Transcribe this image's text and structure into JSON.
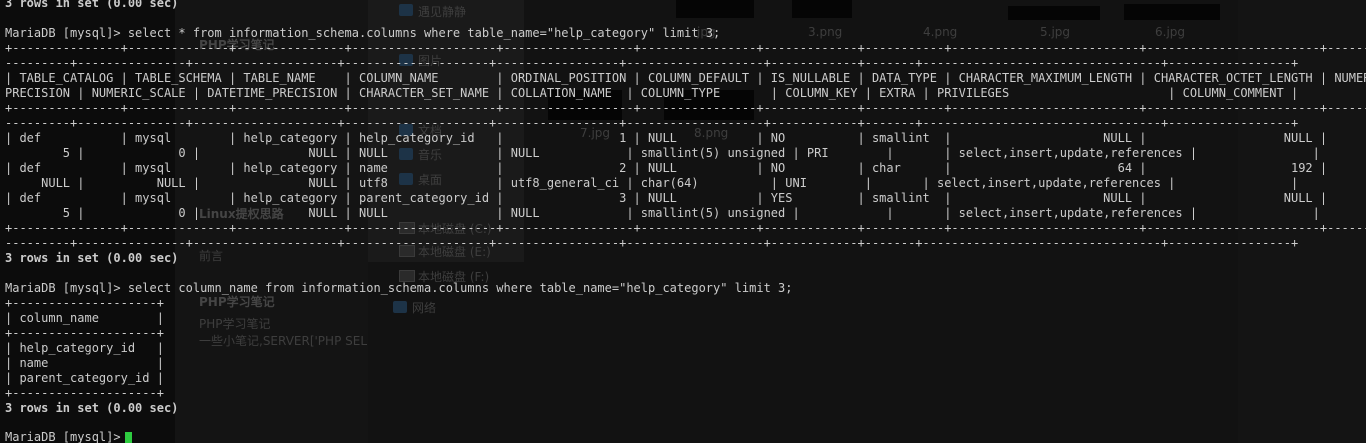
{
  "background_window": {
    "sidebar_items": [
      {
        "label": "遇见静静",
        "icon": "folder-icon"
      },
      {
        "label": "图片",
        "icon": "folder-icon"
      },
      {
        "label": "文档",
        "icon": "folder-icon"
      },
      {
        "label": "音乐",
        "icon": "music-icon"
      },
      {
        "label": "桌面",
        "icon": "desktop-icon"
      },
      {
        "label": "本地磁盘 (C:)",
        "icon": "drive-icon"
      },
      {
        "label": "本地磁盘 (E:)",
        "icon": "drive-icon"
      },
      {
        "label": "本地磁盘 (F:)",
        "icon": "drive-icon"
      },
      {
        "label": "网络",
        "icon": "network-icon"
      }
    ],
    "file_labels": [
      "jpg",
      "3.png",
      "4.png",
      "5.jpg",
      "6.jpg",
      "7.jpg",
      "8.png"
    ],
    "blog_lines": [
      "Linux提权思路",
      "前言",
      "PHP学习笔记",
      "PHP学习笔记",
      "一些小笔记,SERVER['PHP SEL"
    ]
  },
  "terminal": {
    "lines": [
      {
        "text": "3 rows in set (0.00 sec)",
        "bold": true
      },
      {
        "text": ""
      },
      {
        "text": "MariaDB [mysql]> select * from information_schema.columns where table_name=\"help_category\" limit 3;"
      },
      {
        "text": "+---------------+--------------+---------------+--------------------+------------------+----------------+-------------+-----------+--------------------------+------------------------+-----------"
      },
      {
        "text": "---------+---------------+--------------------+--------------------+-----------------+-------------------+------------+-------+---------------------------------+-----------------+"
      },
      {
        "text": "| TABLE_CATALOG | TABLE_SCHEMA | TABLE_NAME    | COLUMN_NAME        | ORDINAL_POSITION | COLUMN_DEFAULT | IS_NULLABLE | DATA_TYPE | CHARACTER_MAXIMUM_LENGTH | CHARACTER_OCTET_LENGTH | NUMERIC_"
      },
      {
        "text": "PRECISION | NUMERIC_SCALE | DATETIME_PRECISION | CHARACTER_SET_NAME | COLLATION_NAME  | COLUMN_TYPE       | COLUMN_KEY | EXTRA | PRIVILEGES                      | COLUMN_COMMENT |"
      },
      {
        "text": "+---------------+--------------+---------------+--------------------+------------------+----------------+-------------+-----------+--------------------------+------------------------+-----------"
      },
      {
        "text": "---------+---------------+--------------------+--------------------+-----------------+-------------------+------------+-------+---------------------------------+-----------------+"
      },
      {
        "text": "| def           | mysql        | help_category | help_category_id   |                1 | NULL           | NO          | smallint  |                     NULL |                   NULL |"
      },
      {
        "text": "        5 |             0 |               NULL | NULL               | NULL            | smallint(5) unsigned | PRI        |       | select,insert,update,references |                |"
      },
      {
        "text": "| def           | mysql        | help_category | name               |                2 | NULL           | NO          | char      |                       64 |                    192 |"
      },
      {
        "text": "     NULL |          NULL |               NULL | utf8               | utf8_general_ci | char(64)          | UNI        |       | select,insert,update,references |                |"
      },
      {
        "text": "| def           | mysql        | help_category | parent_category_id |                3 | NULL           | YES         | smallint  |                     NULL |                   NULL |"
      },
      {
        "text": "        5 |             0 |               NULL | NULL               | NULL            | smallint(5) unsigned |            |       | select,insert,update,references |                |"
      },
      {
        "text": "+---------------+--------------+---------------+--------------------+------------------+----------------+-------------+-----------+--------------------------+------------------------+-----------"
      },
      {
        "text": "---------+---------------+--------------------+--------------------+-----------------+-------------------+------------+-------+---------------------------------+-----------------+"
      },
      {
        "text": "3 rows in set (0.00 sec)",
        "bold": true
      },
      {
        "text": ""
      },
      {
        "text": "MariaDB [mysql]> select column_name from information_schema.columns where table_name=\"help_category\" limit 3;"
      },
      {
        "text": "+--------------------+"
      },
      {
        "text": "| column_name        |"
      },
      {
        "text": "+--------------------+"
      },
      {
        "text": "| help_category_id   |"
      },
      {
        "text": "| name               |"
      },
      {
        "text": "| parent_category_id |"
      },
      {
        "text": "+--------------------+"
      },
      {
        "text": "3 rows in set (0.00 sec)",
        "bold": true
      },
      {
        "text": ""
      },
      {
        "text": "MariaDB [mysql]> "
      }
    ],
    "cursor_color": "#2ecc40",
    "text_color": "#cccccc",
    "background_color": "#0c0c0c"
  }
}
